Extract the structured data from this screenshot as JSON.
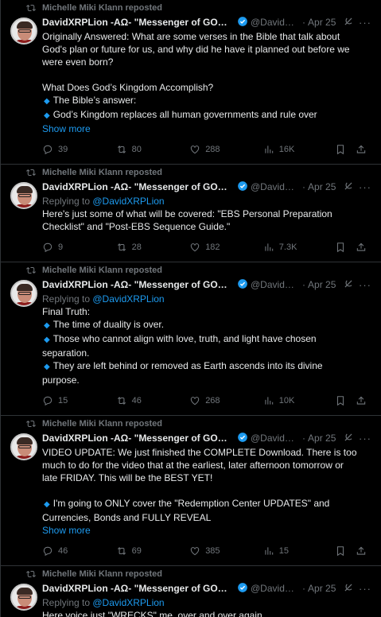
{
  "reposter": "Michelle Miki Klann reposted",
  "author": {
    "name": "DavidXRPLion -AΩ- \"Messenger of GOD'...",
    "handle": "@DavidXRPLion",
    "reply_handle": "@DavidXRPLion"
  },
  "labels": {
    "replying_to": "Replying to ",
    "show_more": "Show more",
    "separator": "·"
  },
  "icons": {
    "repost": "repost-icon",
    "verified": "verified-badge-icon",
    "grok": "grok-icon",
    "more": "more-icon",
    "reply": "reply-icon",
    "like": "heart-icon",
    "views": "views-icon",
    "bookmark": "bookmark-icon",
    "share": "share-icon"
  },
  "colors": {
    "accent": "#1d9bf0",
    "muted": "#71767b",
    "text": "#e7e9ea",
    "border": "#2f3336",
    "background": "#000000"
  },
  "posts": [
    {
      "date": "Apr 25",
      "lines": [
        "Originally Answered: What are some verses in the Bible that talk about",
        "God's plan or future for us, and why did he have it planned out before we",
        "were even born?",
        "",
        "What Does God’s Kingdom Accomplish?",
        "◆ The Bible’s answer:",
        "◆ God’s Kingdom replaces all human governments and rule over"
      ],
      "show_more": true,
      "stats": {
        "replies": "39",
        "reposts": "80",
        "likes": "288",
        "views": "16K"
      }
    },
    {
      "date": "Apr 25",
      "replying": true,
      "lines": [
        "Here's just some of what will be covered: \"EBS Personal Preparation",
        "Checklist\" and \"Post-EBS Sequence Guide.\""
      ],
      "show_more": false,
      "stats": {
        "replies": "9",
        "reposts": "28",
        "likes": "182",
        "views": "7.3K"
      }
    },
    {
      "date": "Apr 25",
      "replying": true,
      "lines": [
        "Final Truth:",
        "◆ The time of duality is over.",
        "◆ Those who cannot align with love, truth, and light have chosen",
        "separation.",
        "◆ They are left behind or removed as Earth ascends into its divine",
        "purpose."
      ],
      "show_more": false,
      "stats": {
        "replies": "15",
        "reposts": "46",
        "likes": "268",
        "views": "10K"
      }
    },
    {
      "date": "Apr 25",
      "lines": [
        "VIDEO UPDATE: We just finished the COMPLETE Download. There is too",
        "much to do for the video that at the earliest, later afternoon tomorrow or",
        "late FRIDAY. This will be the BEST YET!",
        "",
        "◆ I'm going to ONLY cover the \"Redemption Center UPDATES\" and",
        "Currencies, Bonds and FULLY REVEAL"
      ],
      "show_more": true,
      "stats": {
        "replies": "46",
        "reposts": "69",
        "likes": "385",
        "views": "15"
      }
    },
    {
      "date": "Apr 25",
      "replying": true,
      "lines": [
        "Here voice just \"WRECKS\" me, over and over again..."
      ],
      "show_more": false,
      "stats": null
    }
  ]
}
